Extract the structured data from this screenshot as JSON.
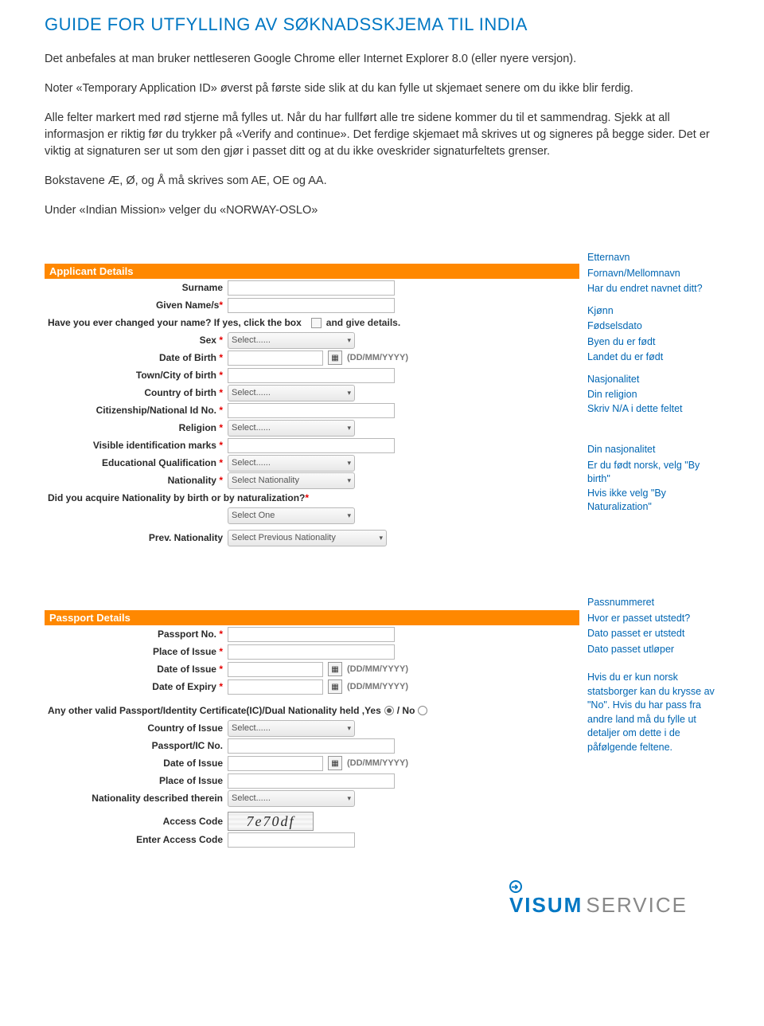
{
  "title": "GUIDE FOR UTFYLLING AV SØKNADSSKJEMA TIL INDIA",
  "intro": {
    "p1": "Det anbefales at man bruker nettleseren Google Chrome eller Internet Explorer 8.0 (eller nyere versjon).",
    "p2": "Noter «Temporary Application ID» øverst på første side slik at du kan fylle ut skjemaet senere om du ikke blir ferdig.",
    "p3": "Alle felter markert med rød stjerne må fylles ut. Når du har fullført alle tre sidene kommer du til et sammendrag. Sjekk at all informasjon er riktig før du trykker på «Verify and continue». Det ferdige skjemaet må skrives ut og signeres på begge sider. Det er viktig at signaturen ser ut som den gjør i passet ditt og at du ikke oveskrider signaturfeltets grenser.",
    "p4": "Bokstavene Æ, Ø, og Å må skrives som AE, OE og AA.",
    "p5": "Under «Indian Mission» velger du «NORWAY-OSLO»"
  },
  "form": {
    "section1": "Applicant Details",
    "surname": "Surname",
    "givenname": "Given Name/s",
    "changedname_q": "Have you ever changed your name? If yes, click the box",
    "changedname_tail": "and give details.",
    "sex": "Sex",
    "dob": "Date of Birth",
    "dob_hint": "(DD/MM/YYYY)",
    "towncity": "Town/City of birth",
    "country": "Country of birth",
    "nid": "Citizenship/National Id No.",
    "religion": "Religion",
    "marks": "Visible identification marks",
    "edu": "Educational Qualification",
    "nationality": "Nationality",
    "acquire_q": "Did you acquire Nationality by birth or by naturalization?",
    "prevnat": "Prev. Nationality",
    "select_ph": "Select......",
    "selectnat_ph": "Select Nationality",
    "selectone_ph": "Select One",
    "selectprev_ph": "Select Previous Nationality",
    "section2": "Passport Details",
    "passport_no": "Passport No.",
    "place_issue": "Place of Issue",
    "date_issue": "Date of Issue",
    "date_expiry": "Date of Expiry",
    "other_q": "Any other valid Passport/Identity Certificate(IC)/Dual Nationality held ,Yes",
    "other_q_no": "/ No",
    "country_issue": "Country of Issue",
    "passport_ic": "Passport/IC No.",
    "date_issue2": "Date of Issue",
    "place_issue2": "Place of Issue",
    "nat_therein": "Nationality described therein",
    "access_code": "Access Code",
    "enter_access": "Enter Access Code",
    "captcha_value": "7e70df"
  },
  "notes1": {
    "n1": "Etternavn",
    "n2": "Fornavn/Mellomnavn",
    "n3": "Har du endret navnet ditt?",
    "n4": "Kjønn",
    "n5": "Fødselsdato",
    "n6": "Byen du er født",
    "n7": "Landet du er født",
    "n8": "Nasjonalitet",
    "n9a": "Din religion",
    "n9b": "Skriv N/A i dette feltet",
    "n10": "Din nasjonalitet",
    "n11a": "Er du født norsk, velg \"By birth\"",
    "n11b": "Hvis ikke velg \"By Naturalization\""
  },
  "notes2": {
    "n1": "Passnummeret",
    "n2": "Hvor er passet utstedt?",
    "n3": "Dato passet er utstedt",
    "n4": "Dato passet utløper",
    "n5": "Hvis du er kun norsk statsborger kan du krysse av \"No\". Hvis du har pass fra andre land må du fylle ut detaljer om dette i de påfølgende feltene."
  },
  "logo": {
    "visum": "VISUM",
    "service": "SERVICE"
  }
}
